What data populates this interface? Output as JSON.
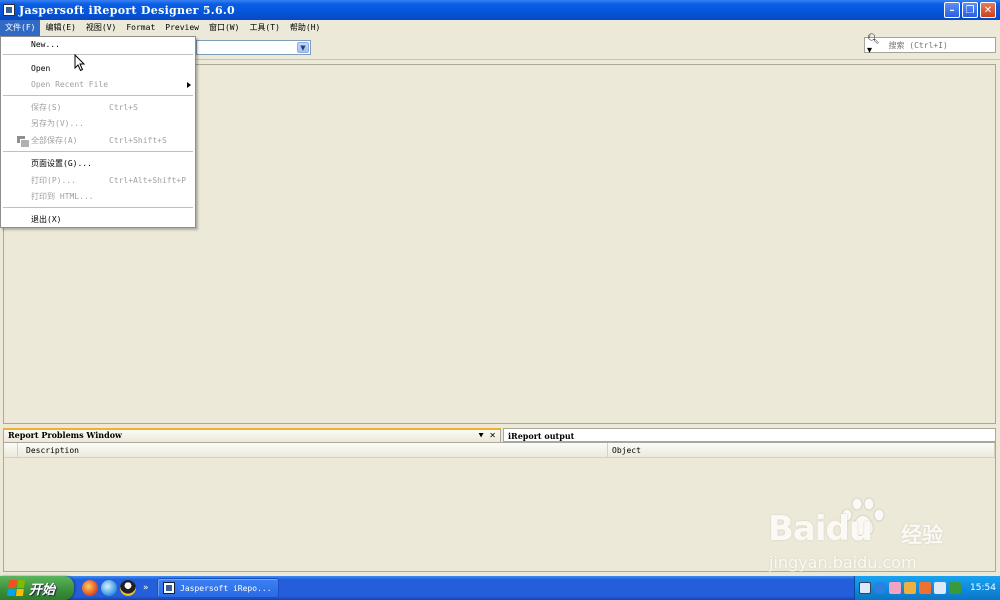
{
  "window": {
    "title": "Jaspersoft iReport Designer 5.6.0"
  },
  "menu": [
    "文件(F)",
    "编辑(E)",
    "视图(V)",
    "Format",
    "Preview",
    "窗口(W)",
    "工具(T)",
    "帮助(H)"
  ],
  "file_menu": [
    {
      "label": "New...",
      "enabled": true
    },
    {
      "label": "Open",
      "enabled": true
    },
    {
      "label": "Open Recent File",
      "enabled": false,
      "submenu": true
    },
    {
      "label": "保存(S)",
      "shortcut": "Ctrl+S",
      "enabled": false
    },
    {
      "label": "另存为(V)...",
      "enabled": false
    },
    {
      "label": "全部保存(A)",
      "shortcut": "Ctrl+Shift+S",
      "enabled": false,
      "icon": "save-all-icon"
    },
    {
      "label": "页面设置(G)...",
      "enabled": true
    },
    {
      "label": "打印(P)...",
      "shortcut": "Ctrl+Alt+Shift+P",
      "enabled": false
    },
    {
      "label": "打印到 HTML...",
      "enabled": false
    },
    {
      "label": "退出(X)",
      "enabled": true
    }
  ],
  "search": {
    "placeholder": "搜索 (Ctrl+I)"
  },
  "bottom_panel": {
    "tab_problems": "Report Problems Window",
    "tab_output": "iReport output",
    "columns": [
      "Description",
      "Object"
    ]
  },
  "taskbar": {
    "start_label": "开始",
    "task_label": "Jaspersoft iRepo...",
    "clock": "15:54"
  },
  "watermark": {
    "brand": "Baidu",
    "cn": "经验",
    "url": "jingyan.baidu.com"
  },
  "colors": {
    "titlebar": "#0453d6",
    "menu_highlight": "#316ac5",
    "tab_accent": "#f0b030",
    "start": "#3a8f3a"
  }
}
